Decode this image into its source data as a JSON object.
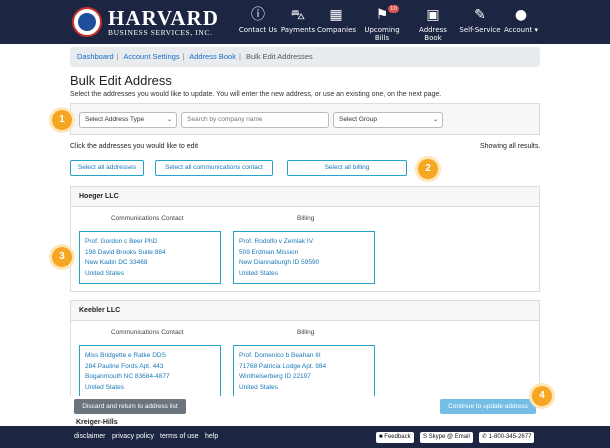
{
  "nav": {
    "logo_big": "HARVARD",
    "logo_small": "BUSINESS SERVICES, INC.",
    "items": [
      {
        "label": "Contact Us",
        "icon": "info-icon",
        "glyph": "ⓘ"
      },
      {
        "label": "Payments",
        "icon": "basket-icon",
        "glyph": "⛍"
      },
      {
        "label": "Companies",
        "icon": "building-icon",
        "glyph": "▦"
      },
      {
        "label": "Upcoming Bills",
        "icon": "flag-icon",
        "glyph": "⚑",
        "badge": "10"
      },
      {
        "label": "Address Book",
        "icon": "address-book-icon",
        "glyph": "▣"
      },
      {
        "label": "Self-Service",
        "icon": "wrench-icon",
        "glyph": "✎"
      },
      {
        "label": "Account ▾",
        "icon": "user-icon",
        "glyph": "●"
      }
    ]
  },
  "breadcrumb": [
    "Dashboard",
    "Account Settings",
    "Address Book",
    "Bulk Edit Addresses"
  ],
  "page": {
    "title": "Bulk Edit Address",
    "subtitle": "Select the addresses you would like to update. You will enter the new address, or use an existing one, on the next page."
  },
  "filters": {
    "address_type": "Select Address Type",
    "search_placeholder": "Search by company name",
    "group": "Select Group"
  },
  "select": {
    "click_label": "Click the addresses you would like to edit",
    "showing": "Showing all results.",
    "all_addresses": "Select all addresses",
    "all_comm": "Select all communications contact",
    "all_billing": "Select all billing"
  },
  "groups": [
    {
      "name": "Hoeger LLC",
      "comm_title": "Communications Contact",
      "billing_title": "Billing",
      "comm": [
        "Prof. Gordon c Beer PhD",
        "198 David Brooks Suite 884",
        "New Kadin DC 33468",
        "United States"
      ],
      "billing": [
        "Prof. Rodolfo v Zemlak IV",
        "509 Erdman Mission",
        "New Diannaburgh ID 59590",
        "United States"
      ]
    },
    {
      "name": "Keebler LLC",
      "comm_title": "Communications Contact",
      "billing_title": "Billing",
      "comm": [
        "Miss Bridgette e Ratke DDS",
        "284 Pauline Fords Apt. 443",
        "Boganmouth NC 83684-4877",
        "United States"
      ],
      "billing": [
        "Prof. Domenico b Beahan III",
        "71768 Patricia Lodge Apt. 984",
        "Wintheiserberg ID 22197",
        "United States"
      ]
    }
  ],
  "next_group": "Kreiger-Hills",
  "actions": {
    "discard": "Discard and return to address list",
    "continue": "Continue to update address"
  },
  "markers": [
    "1",
    "2",
    "3",
    "4"
  ],
  "footer": {
    "links": [
      "disclaimer",
      "privacy policy",
      "terms of use",
      "help"
    ],
    "feedback": "Feedback",
    "skype": "Skype",
    "email": "Email",
    "phone": "1-800-345-2677"
  }
}
